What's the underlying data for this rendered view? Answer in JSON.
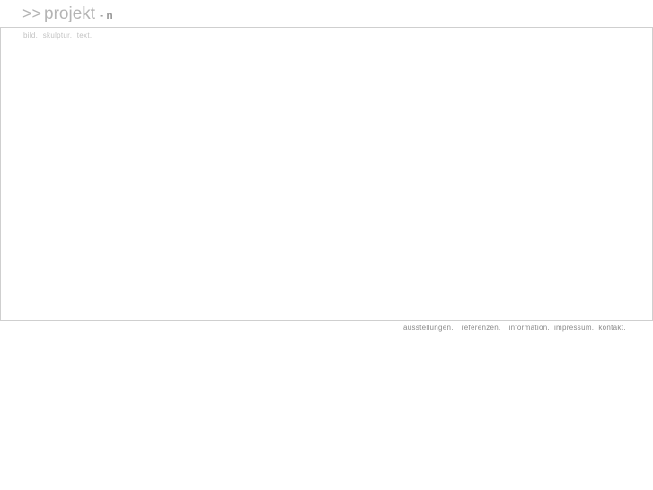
{
  "header": {
    "logo_arrows": ">>",
    "logo_word": "projekt",
    "logo_suffix": "- n"
  },
  "subnav": {
    "items": [
      "bild.",
      "skulptur.",
      "text."
    ]
  },
  "footer_nav": {
    "items": [
      "ausstellungen.",
      "referenzen.",
      "information.",
      "impressum.",
      "kontakt."
    ]
  },
  "colors": {
    "logo": "#b4b4b4",
    "frame_border": "#cfcfcf",
    "subnav_text": "#c2c2c2",
    "footer_text": "#8a8a8a"
  }
}
